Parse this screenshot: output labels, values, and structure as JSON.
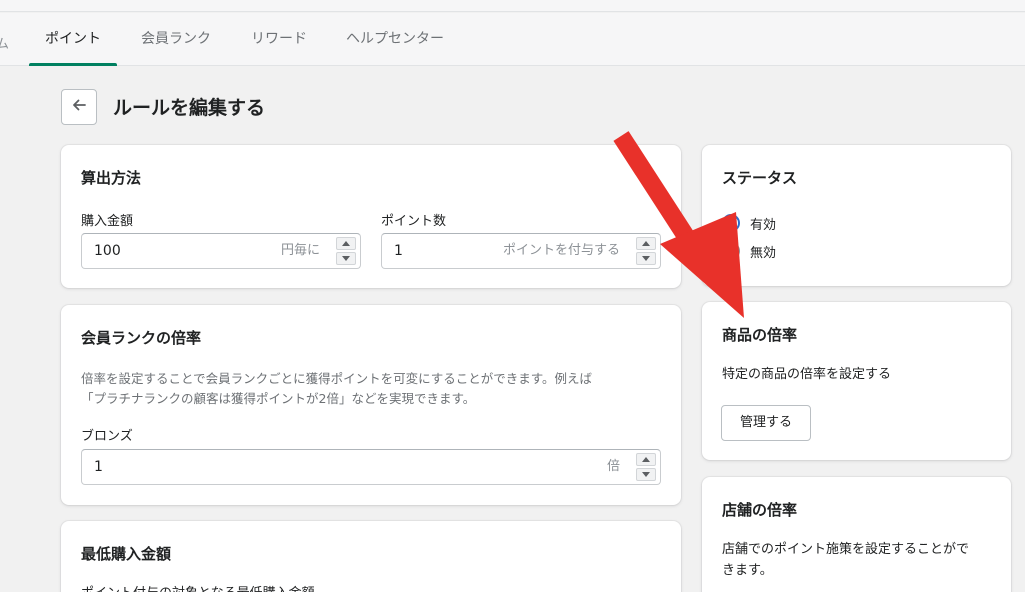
{
  "tabs": {
    "partial": "ム",
    "items": [
      {
        "label": "ポイント",
        "active": true
      },
      {
        "label": "会員ランク",
        "active": false
      },
      {
        "label": "リワード",
        "active": false
      },
      {
        "label": "ヘルプセンター",
        "active": false
      }
    ]
  },
  "page": {
    "title": "ルールを編集する",
    "back_icon": "arrow-left-icon"
  },
  "calc_card": {
    "title": "算出方法",
    "purchase": {
      "label": "購入金額",
      "value": "100",
      "suffix": "円毎に"
    },
    "points": {
      "label": "ポイント数",
      "value": "1",
      "suffix": "ポイントを付与する"
    }
  },
  "rank_card": {
    "title": "会員ランクの倍率",
    "description_line1": "倍率を設定することで会員ランクごとに獲得ポイントを可変にすることができます。例えば",
    "description_line2": "「プラチナランクの顧客は獲得ポイントが2倍」などを実現できます。",
    "bronze": {
      "label": "ブロンズ",
      "value": "1",
      "suffix": "倍"
    }
  },
  "min_card": {
    "title": "最低購入金額",
    "description": "ポイント付与の対象となる最低購入金額"
  },
  "status_card": {
    "title": "ステータス",
    "options": [
      {
        "label": "有効",
        "selected": true
      },
      {
        "label": "無効",
        "selected": false
      }
    ]
  },
  "product_card": {
    "title": "商品の倍率",
    "description": "特定の商品の倍率を設定する",
    "button": "管理する"
  },
  "store_card": {
    "title": "店舗の倍率",
    "description_line1": "店舗でのポイント施策を設定することがで",
    "description_line2": "きます。"
  },
  "colors": {
    "accent": "#008060",
    "radio": "#2c6ecb",
    "annotation_arrow": "#e8312a"
  }
}
